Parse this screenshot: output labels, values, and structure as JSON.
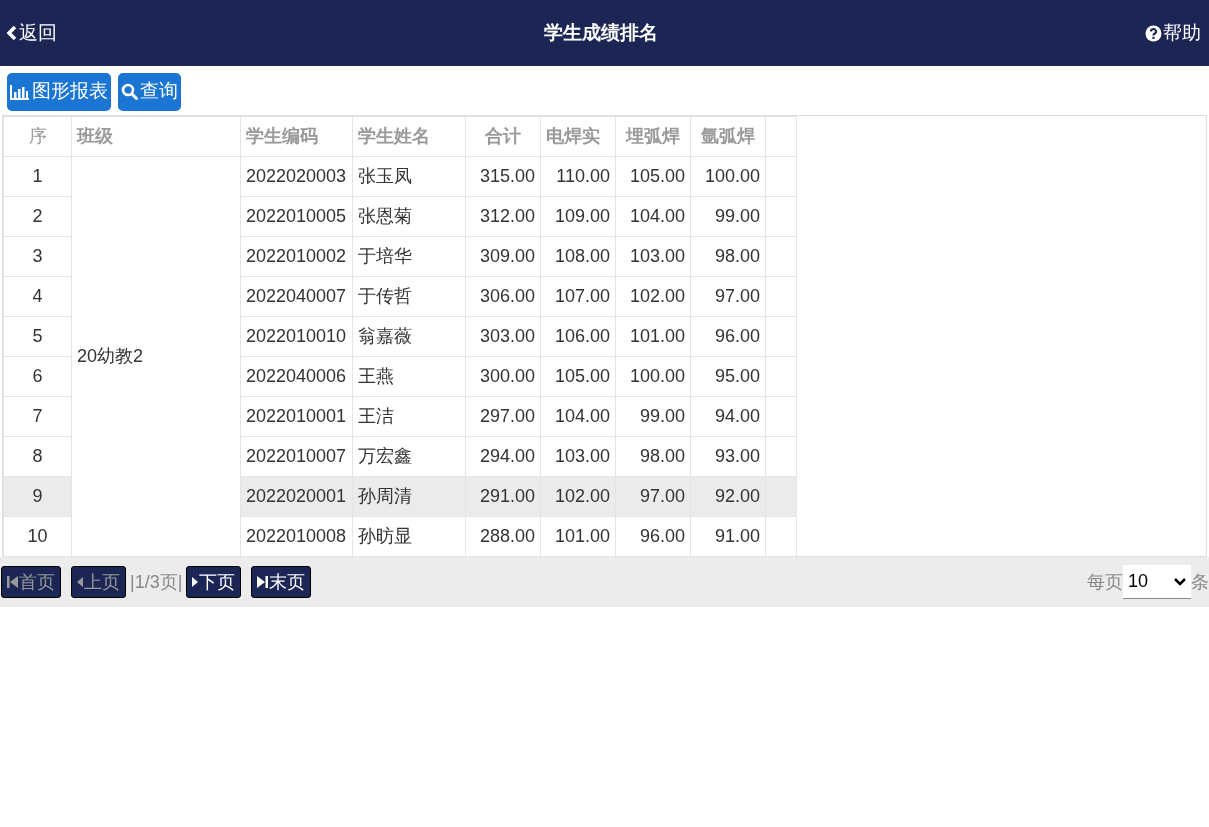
{
  "header": {
    "back": "返回",
    "title": "学生成绩排名",
    "help": "帮助"
  },
  "toolbar": [
    {
      "kind": "chart",
      "label": "图形报表"
    },
    {
      "kind": "search",
      "label": "查询"
    }
  ],
  "table": {
    "columns": [
      "序",
      "班级",
      "学生编码",
      "学生姓名",
      "合计",
      "电焊实",
      "埋弧焊",
      "氩弧焊"
    ],
    "class_cell": "20幼教2",
    "rows": [
      {
        "index": "1",
        "code": "2022020003",
        "name": "张玉凤",
        "total": "315.00",
        "c1": "110.00",
        "c2": "105.00",
        "c3": "100.00",
        "selected": false
      },
      {
        "index": "2",
        "code": "2022010005",
        "name": "张恩菊",
        "total": "312.00",
        "c1": "109.00",
        "c2": "104.00",
        "c3": "99.00",
        "selected": false
      },
      {
        "index": "3",
        "code": "2022010002",
        "name": "于培华",
        "total": "309.00",
        "c1": "108.00",
        "c2": "103.00",
        "c3": "98.00",
        "selected": false
      },
      {
        "index": "4",
        "code": "2022040007",
        "name": "于传哲",
        "total": "306.00",
        "c1": "107.00",
        "c2": "102.00",
        "c3": "97.00",
        "selected": false
      },
      {
        "index": "5",
        "code": "2022010010",
        "name": "翁嘉薇",
        "total": "303.00",
        "c1": "106.00",
        "c2": "101.00",
        "c3": "96.00",
        "selected": false
      },
      {
        "index": "6",
        "code": "2022040006",
        "name": "王燕",
        "total": "300.00",
        "c1": "105.00",
        "c2": "100.00",
        "c3": "95.00",
        "selected": false
      },
      {
        "index": "7",
        "code": "2022010001",
        "name": "王洁",
        "total": "297.00",
        "c1": "104.00",
        "c2": "99.00",
        "c3": "94.00",
        "selected": false
      },
      {
        "index": "8",
        "code": "2022010007",
        "name": "万宏鑫",
        "total": "294.00",
        "c1": "103.00",
        "c2": "98.00",
        "c3": "93.00",
        "selected": false
      },
      {
        "index": "9",
        "code": "2022020001",
        "name": "孙周清",
        "total": "291.00",
        "c1": "102.00",
        "c2": "97.00",
        "c3": "92.00",
        "selected": true
      },
      {
        "index": "10",
        "code": "2022010008",
        "name": "孙昉显",
        "total": "288.00",
        "c1": "101.00",
        "c2": "96.00",
        "c3": "91.00",
        "selected": false
      }
    ]
  },
  "pager": {
    "buttons": [
      {
        "kind": "first",
        "label": "首页",
        "disabled": true
      },
      {
        "kind": "prev",
        "label": "上页",
        "disabled": true
      },
      {
        "kind": "info",
        "label": "|1/3页|"
      },
      {
        "kind": "next",
        "label": "下页",
        "disabled": false
      },
      {
        "kind": "last",
        "label": "末页",
        "disabled": false
      }
    ],
    "per_page_label": "每页",
    "per_page": "10",
    "unit": "条"
  }
}
